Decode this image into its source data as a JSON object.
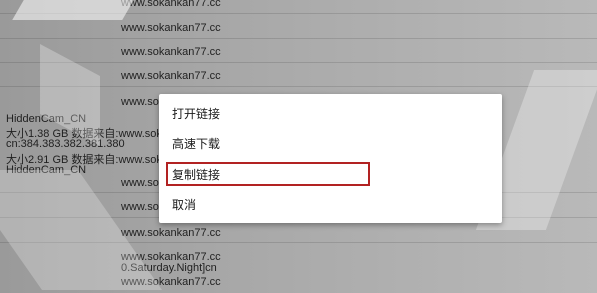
{
  "background_list": {
    "rows": [
      {
        "text": "www.sokankan77.cc"
      },
      {
        "text": "www.sokankan77.cc"
      },
      {
        "text": "www.sokankan77.cc"
      },
      {
        "text": "www.sokankan77.cc"
      },
      {
        "text": "www.sokankan77.cc"
      },
      {
        "text": "HiddenCam_CN"
      },
      {
        "text": "大小1.38 GB  数据来自:www.sokankan77.cc"
      },
      {
        "text": "cn:384.383.382.381.380"
      },
      {
        "text": "大小2.91 GB  数据来自:www.sokankan77.cc"
      },
      {
        "text": "HiddenCam_CN"
      },
      {
        "text": "www.sokankan77.cc"
      },
      {
        "text": "www.sokankan77.cc"
      },
      {
        "text": "www.sokankan77.cc"
      },
      {
        "text": "www.sokankan77.cc"
      },
      {
        "text": "www.sokankan77.cc"
      },
      {
        "text": "0.Saturday.Night]cn"
      },
      {
        "text": "www.sokankan77.cc"
      }
    ]
  },
  "context_menu": {
    "items": [
      {
        "label": "打开链接"
      },
      {
        "label": "高速下载"
      },
      {
        "label": "复制链接"
      },
      {
        "label": "取消"
      }
    ],
    "highlighted_index": 2,
    "highlight_color": "#b22222"
  },
  "colors": {
    "menu_bg": "#ffffff",
    "overlay_bg": "#9a9a9a"
  }
}
